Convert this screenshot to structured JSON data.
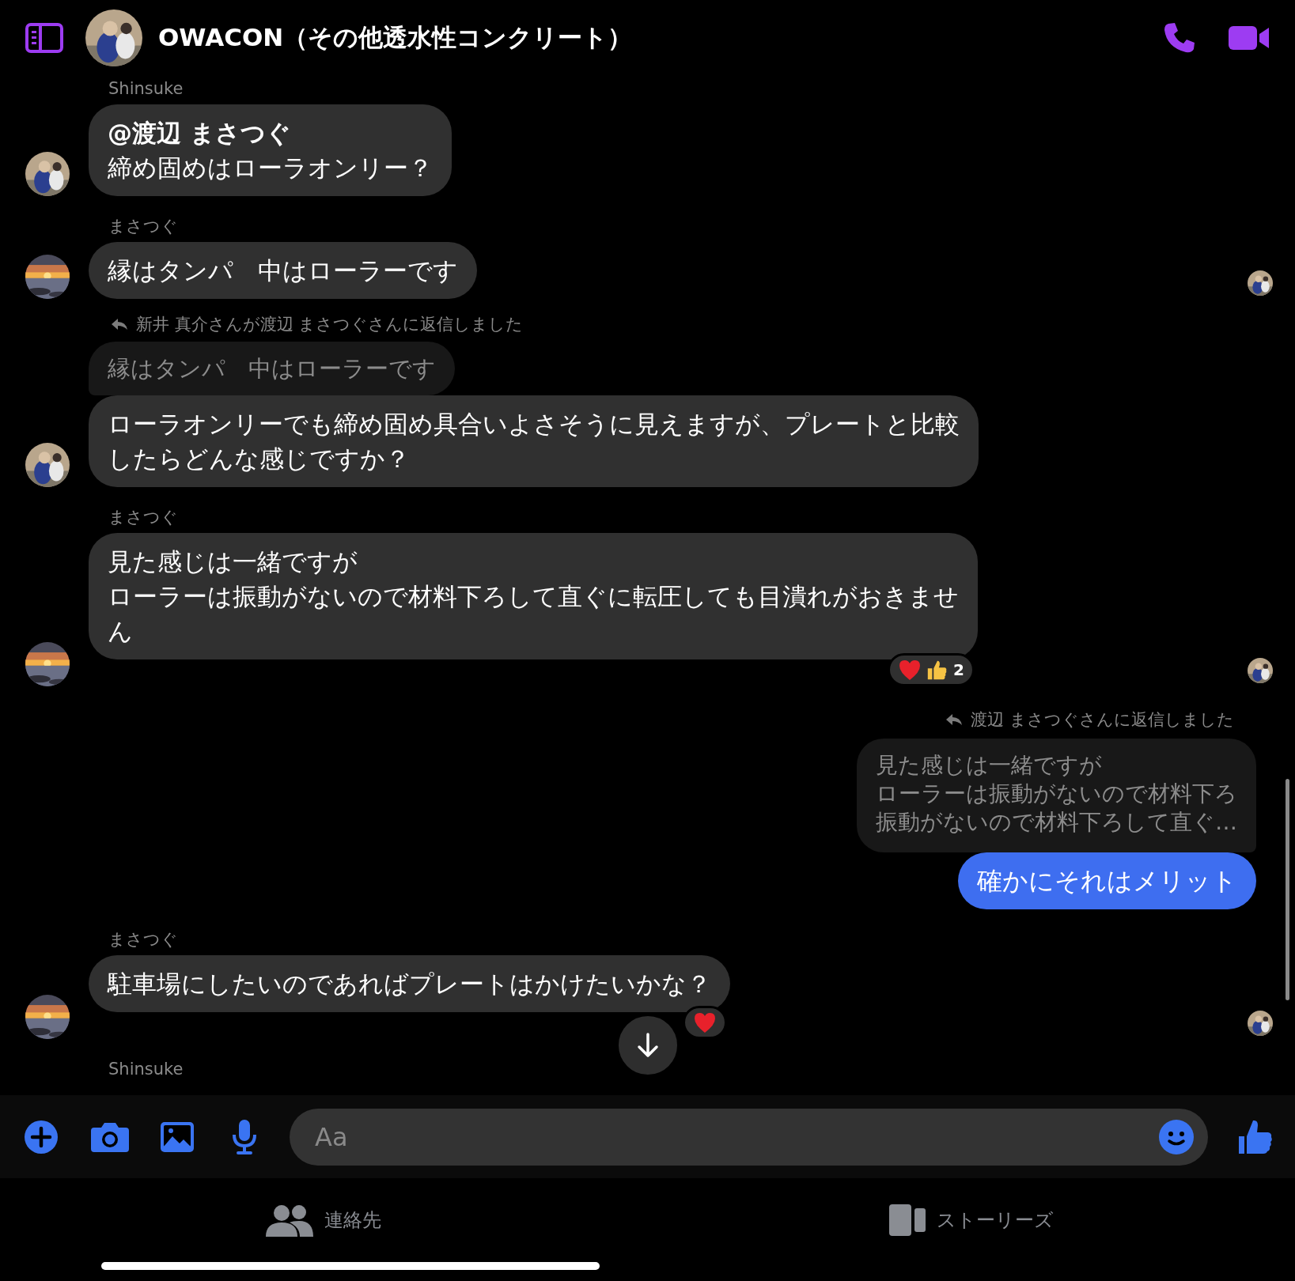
{
  "header": {
    "title": "OWACON（その他透水性コンクリート）"
  },
  "thread": [
    {
      "kind": "incoming",
      "sender": "Shinsuke",
      "lines": [
        "**@渡辺 まさつぐ**",
        "締め固めはローラオンリー？"
      ],
      "read_receipt": false
    },
    {
      "kind": "incoming",
      "sender": "まさつぐ",
      "lines": [
        "縁はタンパ　中はローラーです"
      ],
      "read_receipt": true
    },
    {
      "kind": "incoming",
      "reply_note": "新井 真介さんが渡辺 まさつぐさんに返信しました",
      "quote": [
        "縁はタンパ　中はローラーです"
      ],
      "lines": [
        "ローラオンリーでも締め固め具合いよさそうに見えますが、プレートと比較",
        "したらどんな感じですか？"
      ],
      "read_receipt": false
    },
    {
      "kind": "incoming",
      "sender": "まさつぐ",
      "lines": [
        "見た感じは一緒ですが",
        "ローラーは振動がないので材料下ろして直ぐに転圧しても目潰れがおきませ",
        "ん"
      ],
      "reactions": [
        {
          "kind": "heart"
        },
        {
          "kind": "like"
        }
      ],
      "reaction_count": "2",
      "read_receipt": true
    },
    {
      "kind": "outgoing",
      "reply_note": "渡辺 まさつぐさんに返信しました",
      "quote": [
        "見た感じは一緒ですが",
        "ローラーは振動がないので材料下ろ",
        "振動がないので材料下ろして直ぐ…"
      ],
      "lines": [
        "確かにそれはメリット"
      ],
      "read_receipt": false
    },
    {
      "kind": "incoming",
      "sender": "まさつぐ",
      "lines": [
        "駐車場にしたいのであればプレートはかけたいかな？"
      ],
      "reactions": [
        {
          "kind": "heart"
        }
      ],
      "read_receipt": true
    },
    {
      "kind": "sender",
      "sender": "Shinsuke"
    }
  ],
  "composer": {
    "placeholder": "Aa"
  },
  "tabs": [
    {
      "label": "連絡先",
      "kind": "contacts",
      "selected": false
    },
    {
      "label": "ストーリーズ",
      "kind": "stories",
      "selected": false
    }
  ]
}
